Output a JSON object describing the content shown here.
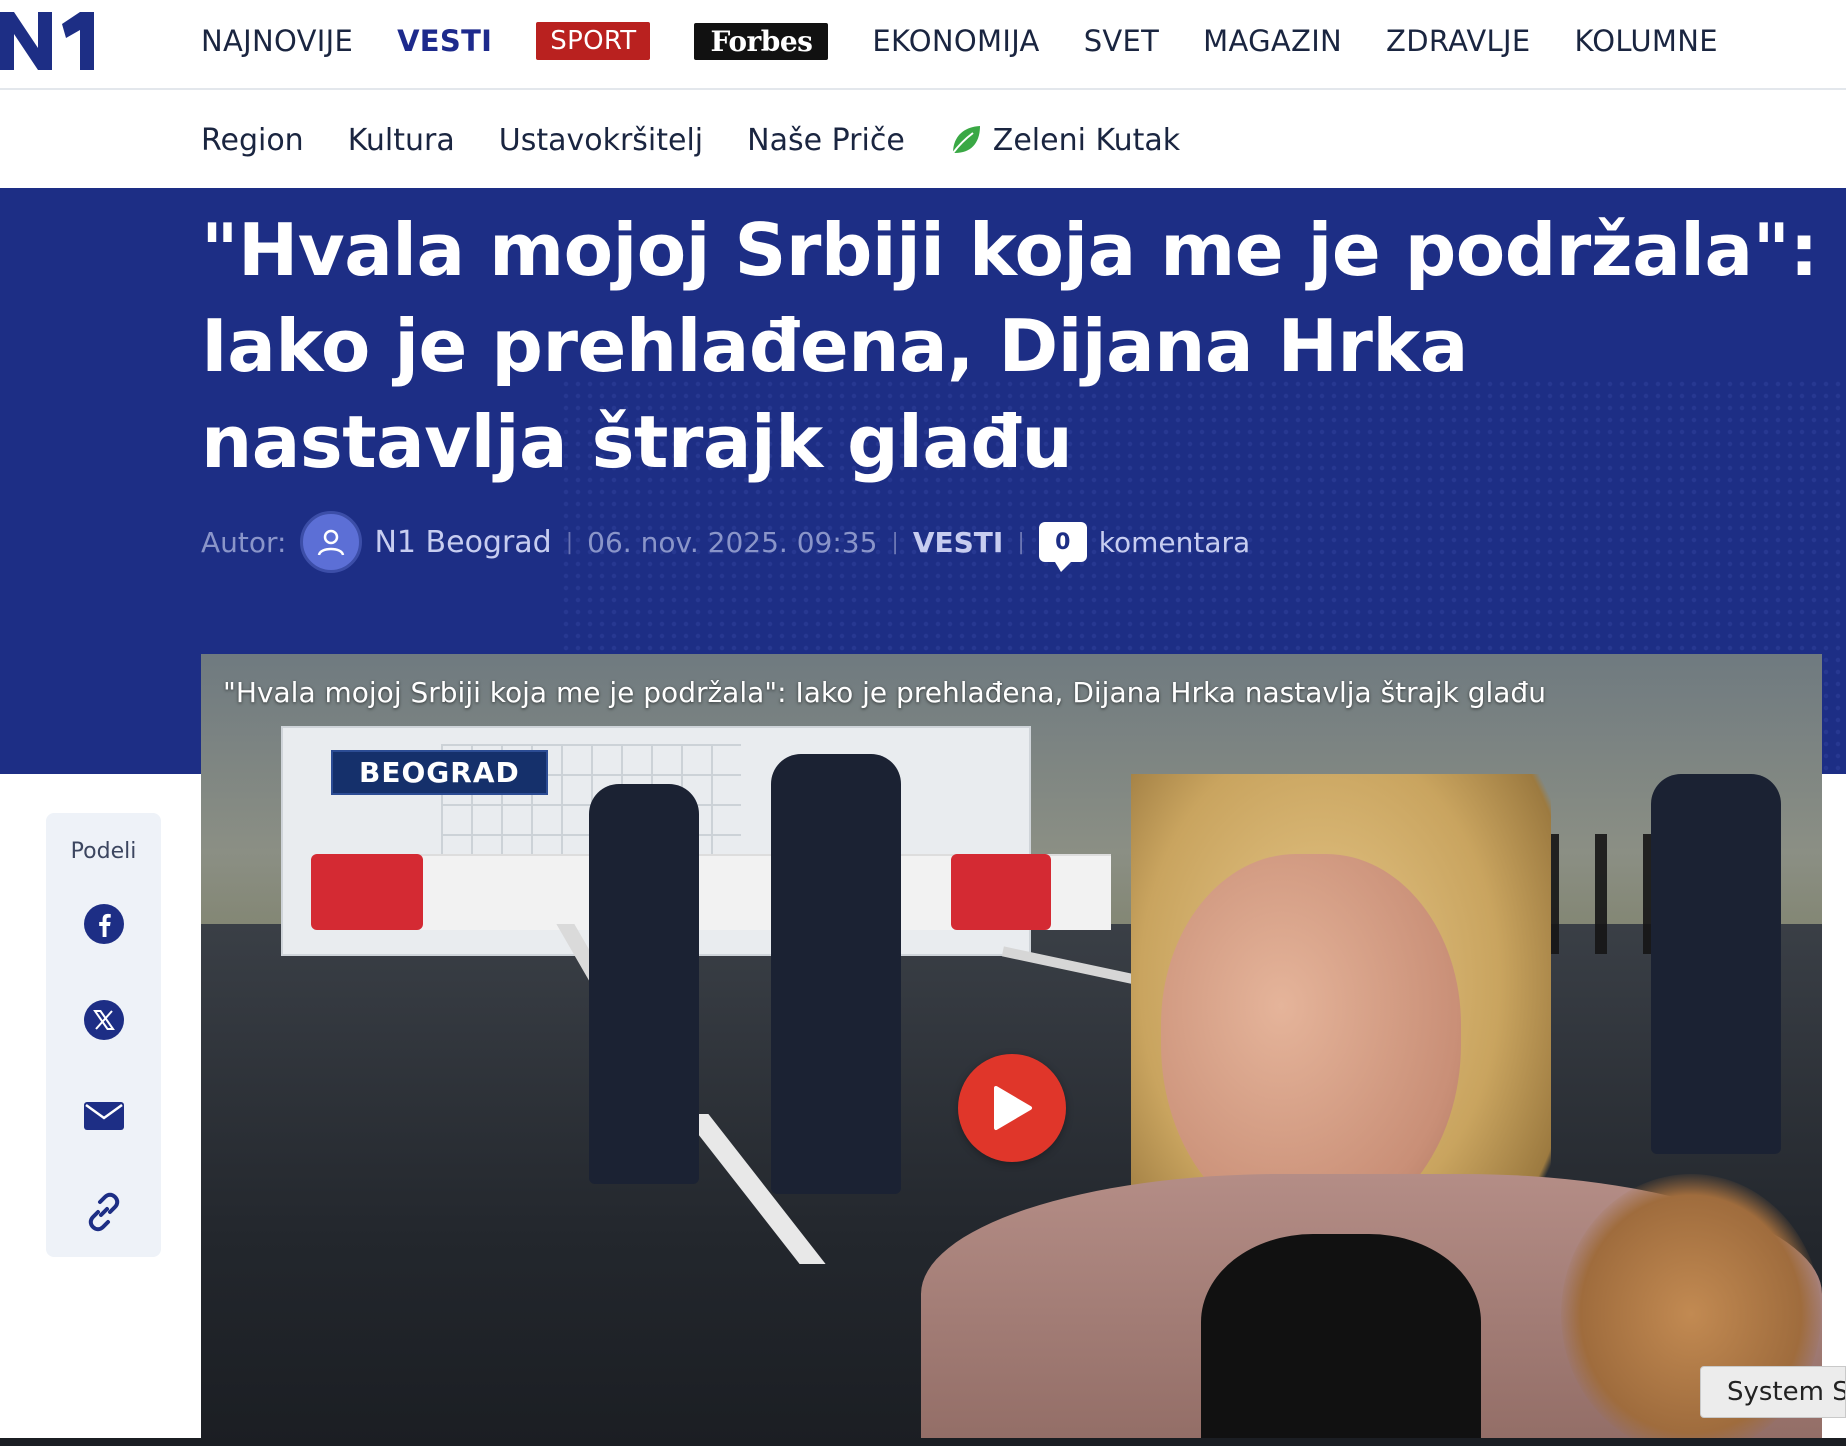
{
  "header": {
    "logo_text": "N1",
    "nav": [
      {
        "label": "NAJNOVIJE"
      },
      {
        "label": "VESTI"
      },
      {
        "label": "SPORT"
      },
      {
        "label": "Forbes"
      },
      {
        "label": "EKONOMIJA"
      },
      {
        "label": "SVET"
      },
      {
        "label": "MAGAZIN"
      },
      {
        "label": "ZDRAVLJE"
      },
      {
        "label": "KOLUMNE"
      }
    ],
    "active": "VESTI"
  },
  "subnav": {
    "items": [
      {
        "label": "Region"
      },
      {
        "label": "Kultura"
      },
      {
        "label": "Ustavokršitelj"
      },
      {
        "label": "Naše Priče"
      },
      {
        "label": "Zeleni Kutak",
        "icon": "leaf-icon"
      }
    ]
  },
  "article": {
    "headline": "\"Hvala mojoj Srbiji koja me je podržala\": Iako je prehlađena, Dijana Hrka nastavlja štrajk glađu",
    "meta": {
      "autor_label": "Autor:",
      "author": "N1 Beograd",
      "date": "06. nov. 2025. 09:35",
      "section": "VESTI",
      "comment_count": "0",
      "comments_label": "komentara"
    }
  },
  "share": {
    "label": "Podeli",
    "buttons": [
      "facebook-icon",
      "x-icon",
      "email-icon",
      "link-icon"
    ]
  },
  "video": {
    "title": "\"Hvala mojoj Srbiji koja me je podržala\": Iako je prehlađena, Dijana Hrka nastavlja štrajk glađu",
    "location": "BEOGRAD"
  },
  "system_tooltip": "System S",
  "colors": {
    "brand_blue": "#1d2e85",
    "sport_red": "#b9211f",
    "play_red": "#e0362a",
    "leaf_green": "#3aa845"
  }
}
